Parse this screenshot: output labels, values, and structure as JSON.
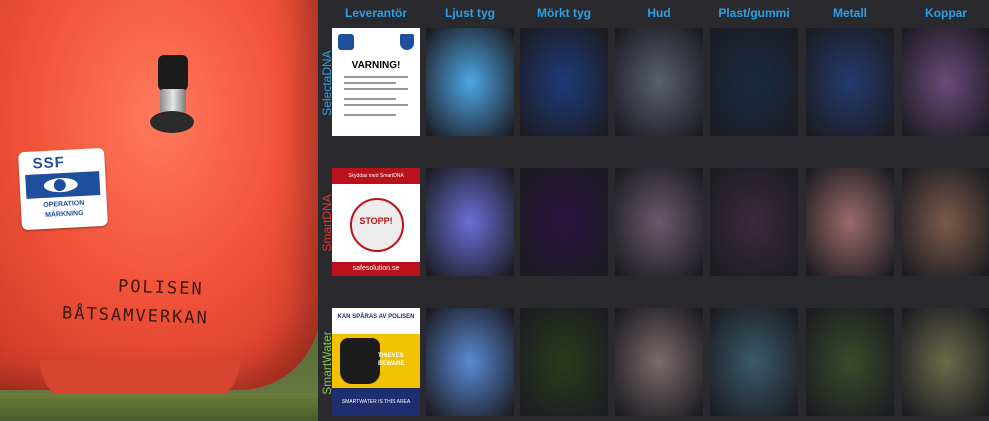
{
  "photo": {
    "sticker": {
      "brand": "SSF",
      "line1": "OPERATION",
      "line2": "MÄRKNING"
    },
    "marker_text": {
      "line1": "POLISEN",
      "line2": "BÅTSAMVERKAN"
    }
  },
  "grid": {
    "columns": [
      "Leverantör",
      "Ljust tyg",
      "Mörkt tyg",
      "Hud",
      "Plast/gummi",
      "Metall",
      "Koppar"
    ],
    "rows": [
      {
        "label": "SelectaDNA",
        "label_color": "#2aa0e6",
        "poster": {
          "title": "VARNING!"
        },
        "tiles": [
          "#4da7e6",
          "#1e3a7a",
          "#5a5f6e",
          "#1a2a44",
          "#243a6e",
          "#6a4a7a"
        ]
      },
      {
        "label": "SmartDNA",
        "label_color": "#e0352a",
        "poster": {
          "header": "Skyddas med SmartDNA",
          "stop": "STOPP!",
          "footer": "safesolution.se"
        },
        "tiles": [
          "#6a6fd6",
          "#2a1440",
          "#6a5a6a",
          "#3a2a3a",
          "#9a6a6a",
          "#7a5a4a"
        ]
      },
      {
        "label": "SmartWater",
        "label_color": "#8bc34a",
        "poster": {
          "header": "KAN SPÅRAS AV POLISEN",
          "thieves": "THIEVES BEWARE",
          "footer": "SMARTWATER IS THIS AREA"
        },
        "tiles": [
          "#5a8ad6",
          "#2a3a1a",
          "#7a6a6a",
          "#3a5a6a",
          "#3a4a2a",
          "#6a6a4a"
        ]
      }
    ]
  }
}
